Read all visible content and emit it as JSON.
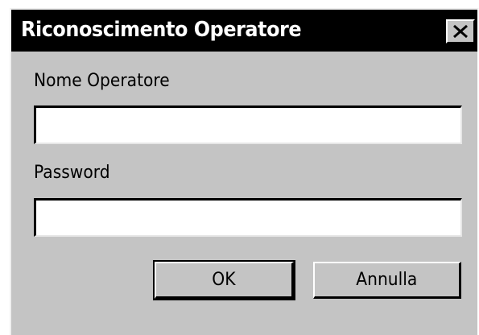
{
  "dialog": {
    "title": "Riconoscimento Operatore",
    "close_glyph": "X",
    "close_icon": "close-icon"
  },
  "form": {
    "operator_name_label": "Nome Operatore",
    "operator_name_value": "",
    "password_label": "Password",
    "password_value": ""
  },
  "buttons": {
    "ok_label": "OK",
    "cancel_label": "Annulla"
  },
  "colors": {
    "titlebar": "#000000",
    "window_face": "#c4c4c4",
    "field_bg": "#ffffff"
  }
}
